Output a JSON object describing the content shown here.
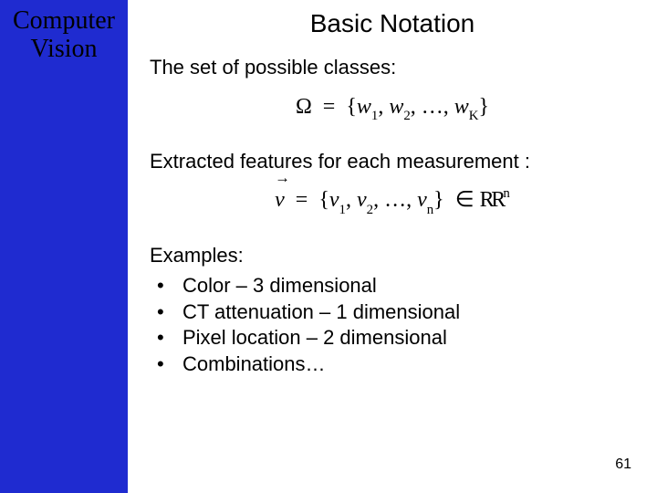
{
  "sidebar": {
    "title_line1": "Computer",
    "title_line2": "Vision"
  },
  "slide": {
    "title": "Basic Notation",
    "para_classes": "The set of possible classes:",
    "formula_classes": {
      "lhs": "Ω",
      "eq": "=",
      "open": "{",
      "items": [
        "w",
        "w",
        "…",
        "w"
      ],
      "subs": [
        "1",
        "2",
        "",
        "K"
      ],
      "close": "}"
    },
    "para_features": "Extracted features for each measurement :",
    "formula_features": {
      "lhs_sym": "v",
      "eq": "=",
      "open": "{",
      "items": [
        "v",
        "v",
        "…",
        "v"
      ],
      "subs": [
        "1",
        "2",
        "",
        "n"
      ],
      "close": "}",
      "in": "∈",
      "space_sym": "R",
      "space_sup": "n"
    },
    "examples_label": "Examples:",
    "examples": [
      "Color – 3 dimensional",
      "CT attenuation – 1 dimensional",
      "Pixel location – 2 dimensional",
      "Combinations…"
    ],
    "page_number": "61"
  }
}
